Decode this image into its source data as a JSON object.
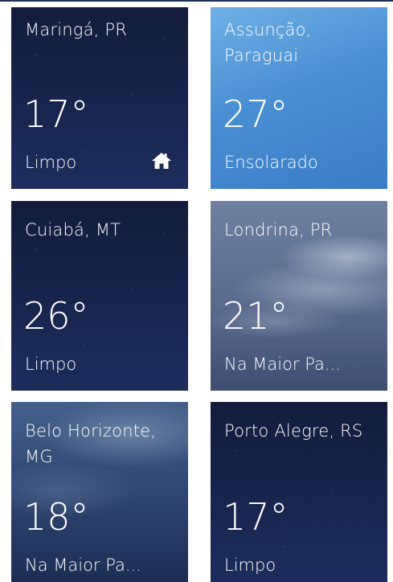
{
  "tiles": [
    {
      "city": "Maringá, PR",
      "temp": "17°",
      "condition": "Limpo",
      "style": "night",
      "home": true,
      "home_icon": "home-icon"
    },
    {
      "city": "Assunção, Paraguai",
      "temp": "27°",
      "condition": "Ensolarado",
      "style": "sunny",
      "home": false
    },
    {
      "city": "Cuiabá, MT",
      "temp": "26°",
      "condition": "Limpo",
      "style": "night",
      "home": false
    },
    {
      "city": "Londrina, PR",
      "temp": "21°",
      "condition": "Na Maior Pa...",
      "style": "cloudy-grey",
      "home": false
    },
    {
      "city": "Belo Horizonte, MG",
      "temp": "18°",
      "condition": "Na Maior Pa...",
      "style": "cloudy-night",
      "home": false
    },
    {
      "city": "Porto Alegre, RS",
      "temp": "17°",
      "condition": "Limpo",
      "style": "night",
      "home": false
    }
  ],
  "colors": {
    "night": "#1a2650",
    "sunny": "#4a8fd3",
    "cloudy": "#5a6a8d",
    "text": "#ffffff"
  }
}
